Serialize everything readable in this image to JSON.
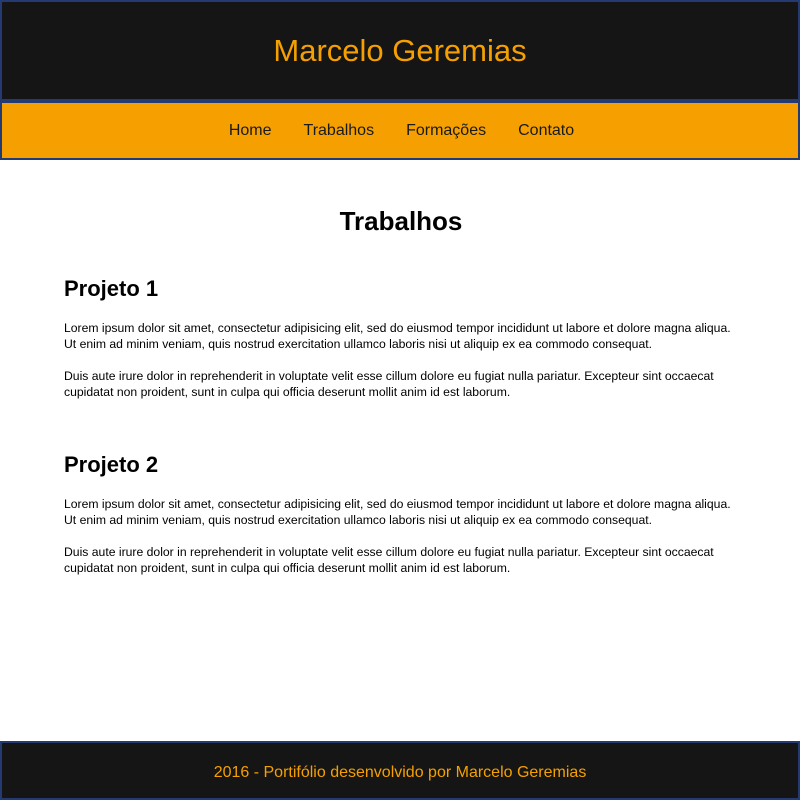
{
  "header": {
    "title": "Marcelo Geremias"
  },
  "nav": {
    "items": [
      {
        "label": "Home"
      },
      {
        "label": "Trabalhos"
      },
      {
        "label": "Formações"
      },
      {
        "label": "Contato"
      }
    ]
  },
  "main": {
    "heading": "Trabalhos",
    "projects": [
      {
        "title": "Projeto 1",
        "paragraphs": [
          "Lorem ipsum dolor sit amet, consectetur adipisicing elit, sed do eiusmod tempor incididunt ut labore et dolore magna aliqua. Ut enim ad minim veniam, quis nostrud exercitation ullamco laboris nisi ut aliquip ex ea commodo consequat.",
          "Duis aute irure dolor in reprehenderit in voluptate velit esse cillum dolore eu fugiat nulla pariatur. Excepteur sint occaecat cupidatat non proident, sunt in culpa qui officia deserunt mollit anim id est laborum."
        ]
      },
      {
        "title": "Projeto 2",
        "paragraphs": [
          "Lorem ipsum dolor sit amet, consectetur adipisicing elit, sed do eiusmod tempor incididunt ut labore et dolore magna aliqua. Ut enim ad minim veniam, quis nostrud exercitation ullamco laboris nisi ut aliquip ex ea commodo consequat.",
          "Duis aute irure dolor in reprehenderit in voluptate velit esse cillum dolore eu fugiat nulla pariatur. Excepteur sint occaecat cupidatat non proident, sunt in culpa qui officia deserunt mollit anim id est laborum."
        ]
      }
    ]
  },
  "footer": {
    "text": "2016 - Portifólio desenvolvido por Marcelo Geremias"
  },
  "colors": {
    "accent": "#f5a000",
    "dark": "#151515",
    "border": "#243a73"
  }
}
